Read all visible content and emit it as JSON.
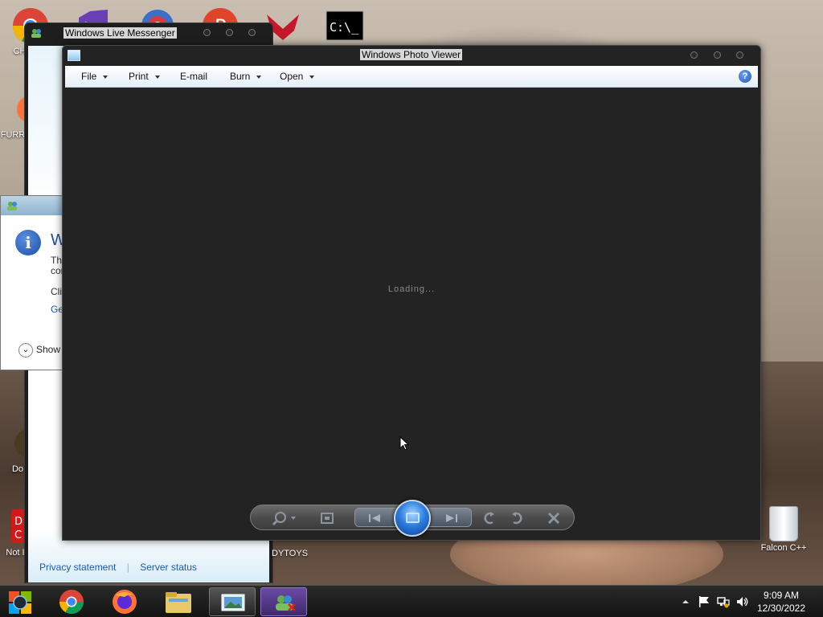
{
  "desktop": {
    "icons": [
      {
        "label": "CH D"
      },
      {
        "label": "FURR"
      },
      {
        "label": "Do"
      },
      {
        "label": "Not I"
      },
      {
        "label": "Falcon C++"
      }
    ],
    "partial_label_toys": "DYTOYS"
  },
  "messenger": {
    "title": "Windows Live Messenger",
    "footer": {
      "privacy": "Privacy statement",
      "server": "Server status"
    }
  },
  "dialog": {
    "heading": "W",
    "line1": "Tha",
    "line2": "con",
    "line3": "Clic",
    "link": "Ge",
    "show": "Show"
  },
  "viewer": {
    "title": "Windows Photo Viewer",
    "menu": {
      "file": "File",
      "print": "Print",
      "email": "E-mail",
      "burn": "Burn",
      "open": "Open"
    },
    "help": "?",
    "loading": "Loading..."
  },
  "taskbar": {
    "clock_time": "9:09 AM",
    "clock_date": "12/30/2022"
  },
  "colors": {
    "menu_bg": "#f1f6fb",
    "viewer_bg": "#232323",
    "accent_blue": "#2d7ee0",
    "link": "#1e5aa8"
  }
}
